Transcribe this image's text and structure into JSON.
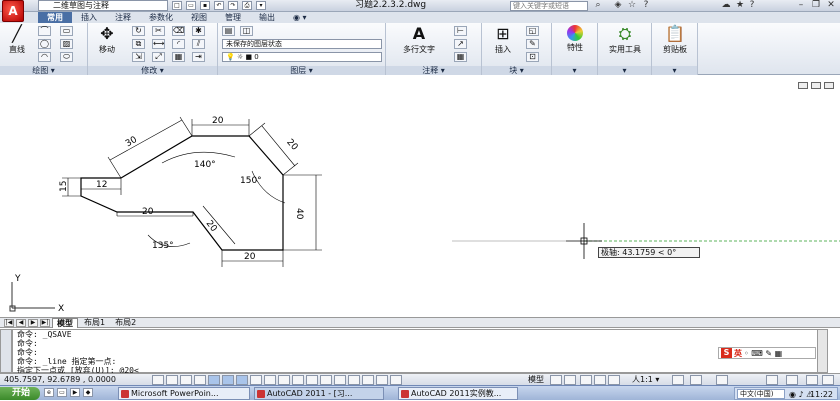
{
  "app": {
    "logo_letter": "A",
    "workspace": "二维草图与注释",
    "doc_title": "习题2.2.3.2.dwg",
    "search_placeholder": "键入关键字或短语"
  },
  "ribbon_tabs": [
    "常用",
    "插入",
    "注释",
    "参数化",
    "视图",
    "管理",
    "输出",
    "◉ ▾"
  ],
  "ribbon": {
    "draw": {
      "title": "绘图 ▾",
      "line": "直线"
    },
    "modify": {
      "title": "修改 ▾",
      "move": "移动"
    },
    "layers": {
      "title": "图层 ▾",
      "layer_state": "未保存的图层状态",
      "current_layer": "0"
    },
    "annotation": {
      "title": "注释 ▾",
      "mtext": "多行文字"
    },
    "block": {
      "title": "块 ▾",
      "insert": "插入"
    },
    "properties": {
      "label": "特性",
      "title": "▾"
    },
    "utilities": {
      "label": "实用工具",
      "title": "▾"
    },
    "clipboard": {
      "label": "剪贴板",
      "title": "▾"
    }
  },
  "drawing": {
    "dims": {
      "d20_top": "20",
      "d30": "30",
      "d20_right_slant": "20",
      "d15": "15",
      "d12": "12",
      "d140": "140°",
      "d150": "150°",
      "d40": "40",
      "d20_mid": "20",
      "d20_lower_slant": "20",
      "d135": "135°",
      "d20_bottom": "20"
    },
    "ucs": {
      "x": "X",
      "y": "Y"
    },
    "polar_tooltip": "极轴: 43.1759 < 0°"
  },
  "layout_tabs": [
    "模型",
    "布局1",
    "布局2"
  ],
  "command_lines": [
    "命令: _QSAVE",
    "命令:",
    "命令:",
    "命令: _line 指定第一点:",
    "指定下一点或 [放弃(U)]: @20<"
  ],
  "status": {
    "coords": "405.7597, 92.6789 , 0.0000",
    "model": "模型",
    "scale": "人1:1 ▾"
  },
  "taskbar": {
    "start": "开始",
    "apps": [
      "Microsoft PowerPoin...",
      "AutoCAD 2011 - [习...",
      "AutoCAD 2011实例教..."
    ],
    "lang": "中文(中国)",
    "clock": "11:22"
  },
  "ime": {
    "s": "S",
    "label": "英"
  },
  "colors": {
    "title_bar": "#c9d1df",
    "active_tab": "#4a6fa5",
    "logo": "#b30000",
    "polar_track": "#2a9a2a"
  }
}
